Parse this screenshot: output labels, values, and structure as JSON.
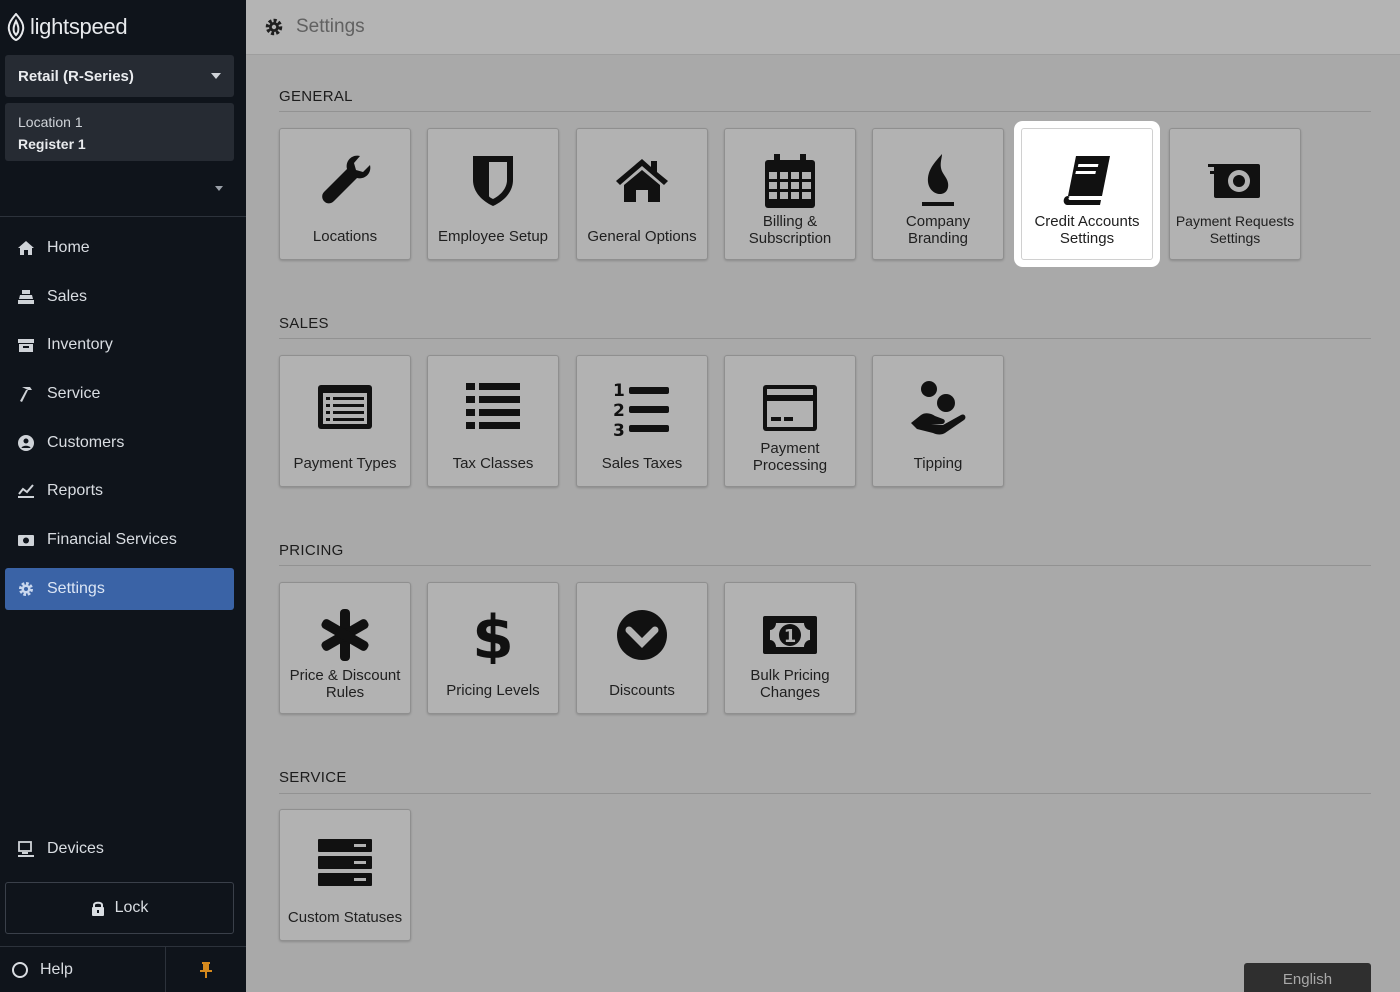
{
  "brand": {
    "name": "lightspeed"
  },
  "sidebar": {
    "store": "Retail (R-Series)",
    "location": "Location 1",
    "register": "Register 1",
    "items": [
      {
        "id": "home",
        "label": "Home",
        "icon": "home-icon"
      },
      {
        "id": "sales",
        "label": "Sales",
        "icon": "register-icon"
      },
      {
        "id": "inventory",
        "label": "Inventory",
        "icon": "box-icon"
      },
      {
        "id": "service",
        "label": "Service",
        "icon": "hammer-icon"
      },
      {
        "id": "customers",
        "label": "Customers",
        "icon": "customer-icon"
      },
      {
        "id": "reports",
        "label": "Reports",
        "icon": "chart-icon"
      },
      {
        "id": "financial-services",
        "label": "Financial Services",
        "icon": "cash-icon"
      },
      {
        "id": "settings",
        "label": "Settings",
        "icon": "gear-icon",
        "active": true
      }
    ],
    "devices": "Devices",
    "lock": "Lock",
    "help": "Help"
  },
  "header": {
    "title": "Settings"
  },
  "sections": [
    {
      "title": "GENERAL",
      "tiles": [
        {
          "label": "Locations",
          "icon": "wrench-icon"
        },
        {
          "label": "Employee Setup",
          "icon": "shield-icon"
        },
        {
          "label": "General Options",
          "icon": "house-icon"
        },
        {
          "label": "Billing & Subscription",
          "icon": "calendar-icon"
        },
        {
          "label": "Company Branding",
          "icon": "flame-icon"
        },
        {
          "label": "Credit Accounts Settings",
          "icon": "book-icon",
          "highlighted": true
        },
        {
          "label": "Payment Requests Settings",
          "icon": "money-icon"
        }
      ]
    },
    {
      "title": "SALES",
      "tiles": [
        {
          "label": "Payment Types",
          "icon": "list-box-icon"
        },
        {
          "label": "Tax Classes",
          "icon": "list-icon"
        },
        {
          "label": "Sales Taxes",
          "icon": "numbered-list-icon"
        },
        {
          "label": "Payment Processing",
          "icon": "credit-card-icon"
        },
        {
          "label": "Tipping",
          "icon": "hand-coins-icon"
        }
      ]
    },
    {
      "title": "PRICING",
      "tiles": [
        {
          "label": "Price & Discount Rules",
          "icon": "asterisk-icon"
        },
        {
          "label": "Pricing Levels",
          "icon": "dollar-icon"
        },
        {
          "label": "Discounts",
          "icon": "check-circle-icon"
        },
        {
          "label": "Bulk Pricing Changes",
          "icon": "banknote-icon"
        }
      ]
    },
    {
      "title": "SERVICE",
      "tiles": [
        {
          "label": "Custom Statuses",
          "icon": "server-icon"
        }
      ]
    }
  ],
  "language": "English"
}
